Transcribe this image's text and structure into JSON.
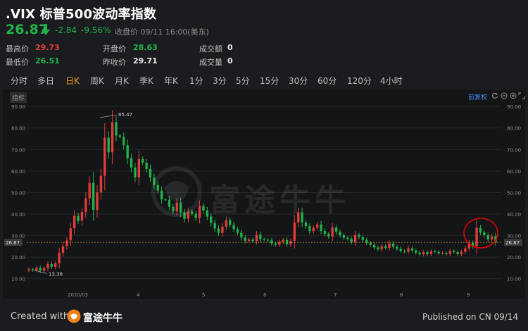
{
  "header": {
    "title": ".VIX 标普500波动率指数",
    "price": "26.87",
    "change": "-2.84",
    "change_pct": "-9.56%",
    "close_label": "收盘价 09/11 16:00(美东)"
  },
  "stats": {
    "high_label": "最高价",
    "high_value": "29.73",
    "low_label": "最低价",
    "low_value": "26.51",
    "open_label": "开盘价",
    "open_value": "28.63",
    "prev_label": "昨收价",
    "prev_value": "29.71",
    "amount_label": "成交额",
    "amount_value": "0",
    "volume_label": "成交量",
    "volume_value": "0"
  },
  "tabs": [
    "分时",
    "多日",
    "日K",
    "周K",
    "月K",
    "季K",
    "年K",
    "1分",
    "3分",
    "5分",
    "15分",
    "30分",
    "60分",
    "120分",
    "4小时"
  ],
  "active_tab": "日K",
  "toolbar": {
    "indicator_label": "指标",
    "adjust_label": "前复权"
  },
  "watermark": {
    "text": "富途牛牛"
  },
  "footer": {
    "created_label": "Created with",
    "brand": "富途牛牛",
    "published": "Published on CN 09/14"
  },
  "colors": {
    "up": "#e23c3c",
    "down": "#20b34a",
    "accent": "#f39c12",
    "highlight_circle": "#e00000"
  },
  "chart_data": {
    "type": "candlestick",
    "ylim": [
      5,
      93
    ],
    "y_ticks": [
      "90.00",
      "80.00",
      "70.00",
      "60.00",
      "50.00",
      "40.00",
      "30.00",
      "20.00",
      "10.00"
    ],
    "x_ticks": [
      "2020/03",
      "4",
      "5",
      "6",
      "7",
      "8",
      "9"
    ],
    "current_price_line": "26.87",
    "max_annotation": "85.47",
    "min_annotation": "13.38",
    "series": [
      {
        "close": 14.4,
        "up": true
      },
      {
        "close": 14.0,
        "up": false
      },
      {
        "close": 15.1,
        "up": true
      },
      {
        "close": 13.7,
        "up": false
      },
      {
        "close": 14.9,
        "up": true
      },
      {
        "close": 16.8,
        "up": true
      },
      {
        "close": 15.5,
        "up": false
      },
      {
        "close": 17.1,
        "up": true
      },
      {
        "close": 22.0,
        "up": true
      },
      {
        "close": 25.1,
        "up": true
      },
      {
        "close": 27.8,
        "up": true
      },
      {
        "close": 33.4,
        "up": true
      },
      {
        "close": 39.2,
        "up": true
      },
      {
        "close": 36.9,
        "up": false
      },
      {
        "close": 41.0,
        "up": true
      },
      {
        "close": 47.3,
        "up": true
      },
      {
        "close": 54.5,
        "up": true
      },
      {
        "close": 41.9,
        "up": false
      },
      {
        "close": 50.1,
        "up": true
      },
      {
        "close": 57.8,
        "up": true
      },
      {
        "close": 75.5,
        "up": true
      },
      {
        "close": 68.7,
        "up": false
      },
      {
        "close": 82.7,
        "up": true
      },
      {
        "close": 76.5,
        "up": false
      },
      {
        "close": 75.9,
        "up": false
      },
      {
        "close": 72.0,
        "up": false
      },
      {
        "close": 66.0,
        "up": false
      },
      {
        "close": 61.6,
        "up": false
      },
      {
        "close": 57.1,
        "up": false
      },
      {
        "close": 65.6,
        "up": true
      },
      {
        "close": 63.9,
        "up": false
      },
      {
        "close": 61.0,
        "up": false
      },
      {
        "close": 57.0,
        "up": false
      },
      {
        "close": 53.5,
        "up": false
      },
      {
        "close": 50.9,
        "up": false
      },
      {
        "close": 46.8,
        "up": false
      },
      {
        "close": 46.7,
        "up": false
      },
      {
        "close": 43.4,
        "up": false
      },
      {
        "close": 41.2,
        "up": false
      },
      {
        "close": 45.4,
        "up": true
      },
      {
        "close": 40.8,
        "up": false
      },
      {
        "close": 37.8,
        "up": false
      },
      {
        "close": 41.2,
        "up": true
      },
      {
        "close": 40.1,
        "up": false
      },
      {
        "close": 38.2,
        "up": false
      },
      {
        "close": 43.8,
        "up": true
      },
      {
        "close": 41.7,
        "up": false
      },
      {
        "close": 38.9,
        "up": false
      },
      {
        "close": 35.9,
        "up": false
      },
      {
        "close": 33.3,
        "up": false
      },
      {
        "close": 31.2,
        "up": false
      },
      {
        "close": 34.2,
        "up": true
      },
      {
        "close": 37.2,
        "up": true
      },
      {
        "close": 35.0,
        "up": false
      },
      {
        "close": 33.0,
        "up": false
      },
      {
        "close": 31.3,
        "up": false
      },
      {
        "close": 29.1,
        "up": false
      },
      {
        "close": 27.6,
        "up": false
      },
      {
        "close": 28.2,
        "up": true
      },
      {
        "close": 27.5,
        "up": false
      },
      {
        "close": 30.5,
        "up": true
      },
      {
        "close": 28.4,
        "up": false
      },
      {
        "close": 28.1,
        "up": false
      },
      {
        "close": 27.8,
        "up": false
      },
      {
        "close": 26.4,
        "up": false
      },
      {
        "close": 25.8,
        "up": false
      },
      {
        "close": 27.1,
        "up": true
      },
      {
        "close": 28.0,
        "up": true
      },
      {
        "close": 26.0,
        "up": false
      },
      {
        "close": 27.6,
        "up": true
      },
      {
        "close": 36.1,
        "up": true
      },
      {
        "close": 40.8,
        "up": true
      },
      {
        "close": 36.1,
        "up": false
      },
      {
        "close": 34.4,
        "up": false
      },
      {
        "close": 32.1,
        "up": false
      },
      {
        "close": 33.7,
        "up": true
      },
      {
        "close": 35.2,
        "up": true
      },
      {
        "close": 32.2,
        "up": false
      },
      {
        "close": 30.8,
        "up": false
      },
      {
        "close": 29.6,
        "up": false
      },
      {
        "close": 33.8,
        "up": true
      },
      {
        "close": 31.8,
        "up": false
      },
      {
        "close": 30.2,
        "up": false
      },
      {
        "close": 29.0,
        "up": false
      },
      {
        "close": 28.5,
        "up": false
      },
      {
        "close": 27.0,
        "up": false
      },
      {
        "close": 30.4,
        "up": true
      },
      {
        "close": 29.3,
        "up": false
      },
      {
        "close": 28.0,
        "up": false
      },
      {
        "close": 26.7,
        "up": false
      },
      {
        "close": 25.7,
        "up": false
      },
      {
        "close": 24.5,
        "up": false
      },
      {
        "close": 23.6,
        "up": false
      },
      {
        "close": 25.1,
        "up": true
      },
      {
        "close": 24.3,
        "up": false
      },
      {
        "close": 26.4,
        "up": true
      },
      {
        "close": 24.8,
        "up": false
      },
      {
        "close": 23.9,
        "up": false
      },
      {
        "close": 22.9,
        "up": false
      },
      {
        "close": 22.5,
        "up": false
      },
      {
        "close": 24.1,
        "up": true
      },
      {
        "close": 23.1,
        "up": false
      },
      {
        "close": 22.1,
        "up": false
      },
      {
        "close": 21.3,
        "up": false
      },
      {
        "close": 22.3,
        "up": true
      },
      {
        "close": 21.4,
        "up": false
      },
      {
        "close": 22.7,
        "up": true
      },
      {
        "close": 22.4,
        "up": false
      },
      {
        "close": 21.8,
        "up": false
      },
      {
        "close": 22.0,
        "up": true
      },
      {
        "close": 21.5,
        "up": false
      },
      {
        "close": 22.9,
        "up": true
      },
      {
        "close": 22.3,
        "up": false
      },
      {
        "close": 21.4,
        "up": false
      },
      {
        "close": 22.5,
        "up": true
      },
      {
        "close": 24.1,
        "up": true
      },
      {
        "close": 26.6,
        "up": true
      },
      {
        "close": 25.1,
        "up": false
      },
      {
        "close": 33.6,
        "up": true
      },
      {
        "close": 31.5,
        "up": false
      },
      {
        "close": 30.2,
        "up": false
      },
      {
        "close": 28.2,
        "up": false
      },
      {
        "close": 29.7,
        "up": true
      },
      {
        "close": 26.9,
        "up": false
      }
    ]
  }
}
